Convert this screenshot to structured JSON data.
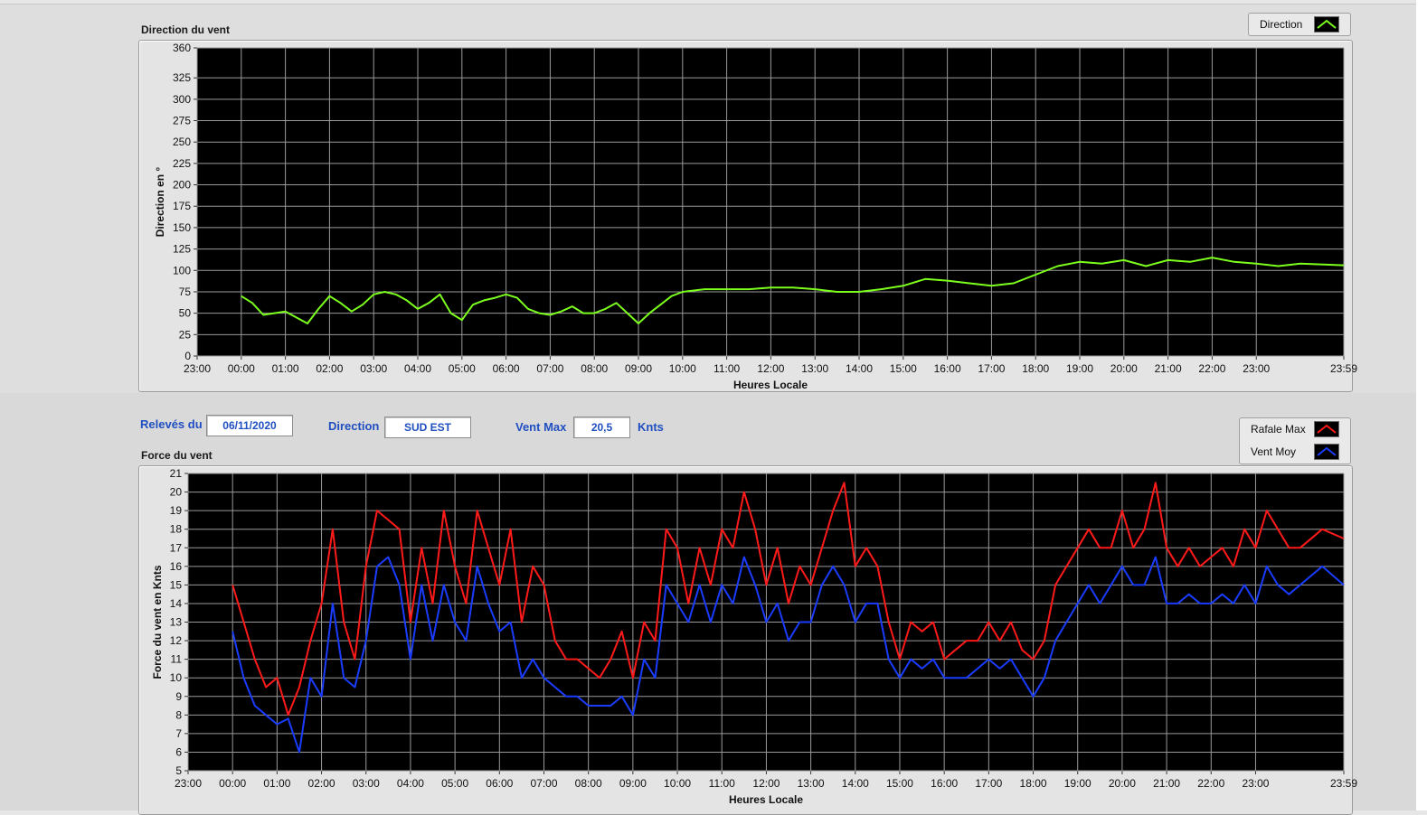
{
  "top_panel": {
    "title": "Direction du vent",
    "legend": [
      {
        "label": "Direction",
        "color": "#7dff1e"
      }
    ]
  },
  "info": {
    "releves_label": "Relevés du",
    "date": "06/11/2020",
    "direction_label": "Direction",
    "direction_value": "SUD EST",
    "ventmax_label": "Vent Max",
    "ventmax_value": "20,5",
    "unit": "Knts"
  },
  "bottom_panel": {
    "title": "Force du vent",
    "legend": [
      {
        "label": "Rafale Max",
        "color": "#ff1a1a"
      },
      {
        "label": "Vent Moy",
        "color": "#1a3cff"
      }
    ]
  },
  "chart_data": [
    {
      "type": "line",
      "title": "Direction du vent",
      "xlabel": "Heures Locale",
      "ylabel": "Direction en °",
      "x_ticks": [
        "23:00",
        "00:00",
        "01:00",
        "02:00",
        "03:00",
        "04:00",
        "05:00",
        "06:00",
        "07:00",
        "08:00",
        "09:00",
        "10:00",
        "11:00",
        "12:00",
        "13:00",
        "14:00",
        "15:00",
        "16:00",
        "17:00",
        "18:00",
        "19:00",
        "20:00",
        "21:00",
        "22:00",
        "23:00",
        "23:59"
      ],
      "y_ticks": [
        0,
        25,
        50,
        75,
        100,
        125,
        150,
        175,
        200,
        225,
        250,
        275,
        300,
        325,
        360
      ],
      "ylim": [
        0,
        360
      ],
      "xlim_hours": [
        -1,
        24.983
      ],
      "grid": true,
      "legend_position": "top-right",
      "series": [
        {
          "name": "Direction",
          "color": "#7dff1e",
          "x": [
            0,
            0.25,
            0.5,
            0.75,
            1,
            1.25,
            1.5,
            1.75,
            2,
            2.25,
            2.5,
            2.75,
            3,
            3.25,
            3.5,
            3.75,
            4,
            4.25,
            4.5,
            4.75,
            5,
            5.25,
            5.5,
            5.75,
            6,
            6.25,
            6.5,
            6.75,
            7,
            7.25,
            7.5,
            7.75,
            8,
            8.25,
            8.5,
            8.75,
            9,
            9.25,
            9.5,
            9.75,
            10,
            10.5,
            11,
            11.5,
            12,
            12.5,
            13,
            13.5,
            14,
            14.5,
            15,
            15.5,
            16,
            16.5,
            17,
            17.5,
            18,
            18.5,
            19,
            19.5,
            20,
            20.5,
            21,
            21.5,
            22,
            22.5,
            23,
            23.5,
            24,
            24.98
          ],
          "values": [
            70,
            62,
            48,
            50,
            52,
            45,
            38,
            55,
            70,
            62,
            52,
            60,
            72,
            75,
            72,
            65,
            55,
            62,
            72,
            50,
            42,
            60,
            65,
            68,
            72,
            68,
            55,
            50,
            48,
            52,
            58,
            50,
            50,
            55,
            62,
            50,
            38,
            50,
            60,
            70,
            75,
            78,
            78,
            78,
            80,
            80,
            78,
            75,
            75,
            78,
            82,
            90,
            88,
            85,
            82,
            85,
            95,
            105,
            110,
            108,
            112,
            105,
            112,
            110,
            115,
            110,
            108,
            105,
            108,
            106
          ]
        }
      ]
    },
    {
      "type": "line",
      "title": "Force du vent",
      "xlabel": "Heures Locale",
      "ylabel": "Force du vent en Knts",
      "x_ticks": [
        "23:00",
        "00:00",
        "01:00",
        "02:00",
        "03:00",
        "04:00",
        "05:00",
        "06:00",
        "07:00",
        "08:00",
        "09:00",
        "10:00",
        "11:00",
        "12:00",
        "13:00",
        "14:00",
        "15:00",
        "16:00",
        "17:00",
        "18:00",
        "19:00",
        "20:00",
        "21:00",
        "22:00",
        "23:00",
        "23:59"
      ],
      "y_ticks": [
        5,
        6,
        7,
        8,
        9,
        10,
        11,
        12,
        13,
        14,
        15,
        16,
        17,
        18,
        19,
        20,
        21
      ],
      "ylim": [
        5,
        21
      ],
      "xlim_hours": [
        -1,
        24.983
      ],
      "grid": true,
      "legend_position": "top-right",
      "series": [
        {
          "name": "Rafale Max",
          "color": "#ff1a1a",
          "x": [
            0,
            0.25,
            0.5,
            0.75,
            1,
            1.25,
            1.5,
            1.75,
            2,
            2.25,
            2.5,
            2.75,
            3,
            3.25,
            3.5,
            3.75,
            4,
            4.25,
            4.5,
            4.75,
            5,
            5.25,
            5.5,
            5.75,
            6,
            6.25,
            6.5,
            6.75,
            7,
            7.25,
            7.5,
            7.75,
            8,
            8.25,
            8.5,
            8.75,
            9,
            9.25,
            9.5,
            9.75,
            10,
            10.25,
            10.5,
            10.75,
            11,
            11.25,
            11.5,
            11.75,
            12,
            12.25,
            12.5,
            12.75,
            13,
            13.25,
            13.5,
            13.75,
            14,
            14.25,
            14.5,
            14.75,
            15,
            15.25,
            15.5,
            15.75,
            16,
            16.25,
            16.5,
            16.75,
            17,
            17.25,
            17.5,
            17.75,
            18,
            18.25,
            18.5,
            18.75,
            19,
            19.25,
            19.5,
            19.75,
            20,
            20.25,
            20.5,
            20.75,
            21,
            21.25,
            21.5,
            21.75,
            22,
            22.25,
            22.5,
            22.75,
            23,
            23.25,
            23.5,
            23.75,
            24,
            24.5,
            24.98
          ],
          "values": [
            15,
            13,
            11,
            9.5,
            10,
            8,
            9.5,
            12,
            14,
            18,
            13,
            11,
            16,
            19,
            18.5,
            18,
            13,
            17,
            14,
            19,
            16,
            14,
            19,
            17,
            15,
            18,
            13,
            16,
            15,
            12,
            11,
            11,
            10.5,
            10,
            11,
            12.5,
            10,
            13,
            12,
            18,
            17,
            14,
            17,
            15,
            18,
            17,
            20,
            18,
            15,
            17,
            14,
            16,
            15,
            17,
            19,
            20.5,
            16,
            17,
            16,
            13,
            11,
            13,
            12.5,
            13,
            11,
            11.5,
            12,
            12,
            13,
            12,
            13,
            11.5,
            11,
            12,
            15,
            16,
            17,
            18,
            17,
            17,
            19,
            17,
            18,
            20.5,
            17,
            16,
            17,
            16,
            16.5,
            17,
            16,
            18,
            17,
            19,
            18,
            17,
            17,
            18,
            17.5
          ]
        },
        {
          "name": "Vent Moy",
          "color": "#1a3cff",
          "x": [
            0,
            0.25,
            0.5,
            0.75,
            1,
            1.25,
            1.5,
            1.75,
            2,
            2.25,
            2.5,
            2.75,
            3,
            3.25,
            3.5,
            3.75,
            4,
            4.25,
            4.5,
            4.75,
            5,
            5.25,
            5.5,
            5.75,
            6,
            6.25,
            6.5,
            6.75,
            7,
            7.25,
            7.5,
            7.75,
            8,
            8.25,
            8.5,
            8.75,
            9,
            9.25,
            9.5,
            9.75,
            10,
            10.25,
            10.5,
            10.75,
            11,
            11.25,
            11.5,
            11.75,
            12,
            12.25,
            12.5,
            12.75,
            13,
            13.25,
            13.5,
            13.75,
            14,
            14.25,
            14.5,
            14.75,
            15,
            15.25,
            15.5,
            15.75,
            16,
            16.25,
            16.5,
            16.75,
            17,
            17.25,
            17.5,
            17.75,
            18,
            18.25,
            18.5,
            18.75,
            19,
            19.25,
            19.5,
            19.75,
            20,
            20.25,
            20.5,
            20.75,
            21,
            21.25,
            21.5,
            21.75,
            22,
            22.25,
            22.5,
            22.75,
            23,
            23.25,
            23.5,
            23.75,
            24,
            24.5,
            24.98
          ],
          "values": [
            12.5,
            10,
            8.5,
            8,
            7.5,
            7.8,
            6,
            10,
            9,
            14,
            10,
            9.5,
            12,
            16,
            16.5,
            15,
            11,
            15,
            12,
            15,
            13,
            12,
            16,
            14,
            12.5,
            13,
            10,
            11,
            10,
            9.5,
            9,
            9,
            8.5,
            8.5,
            8.5,
            9,
            8,
            11,
            10,
            15,
            14,
            13,
            15,
            13,
            15,
            14,
            16.5,
            15,
            13,
            14,
            12,
            13,
            13,
            15,
            16,
            15,
            13,
            14,
            14,
            11,
            10,
            11,
            10.5,
            11,
            10,
            10,
            10,
            10.5,
            11,
            10.5,
            11,
            10,
            9,
            10,
            12,
            13,
            14,
            15,
            14,
            15,
            16,
            15,
            15,
            16.5,
            14,
            14,
            14.5,
            14,
            14,
            14.5,
            14,
            15,
            14,
            16,
            15,
            14.5,
            15,
            16,
            15
          ]
        }
      ]
    }
  ]
}
